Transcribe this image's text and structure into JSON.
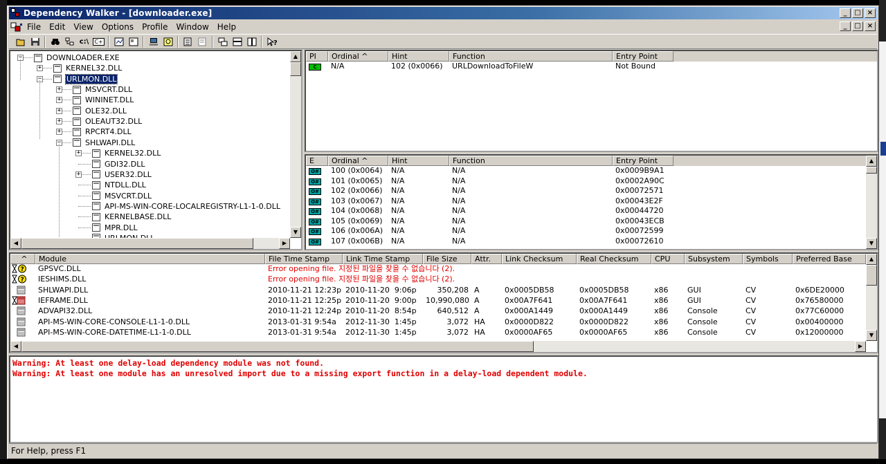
{
  "window": {
    "title": "Dependency Walker - [downloader.exe]",
    "btn_min": "_",
    "btn_max": "□",
    "btn_close": "×"
  },
  "menu": [
    "File",
    "Edit",
    "View",
    "Options",
    "Profile",
    "Window",
    "Help"
  ],
  "toolbar": {
    "c_label": "c:\\",
    "cplus_label": "C+"
  },
  "tree": [
    {
      "label": "DOWNLOADER.EXE",
      "depth": 0,
      "expander": "−"
    },
    {
      "label": "KERNEL32.DLL",
      "depth": 1,
      "expander": "+"
    },
    {
      "label": "URLMON.DLL",
      "depth": 1,
      "expander": "−",
      "selected": true
    },
    {
      "label": "MSVCRT.DLL",
      "depth": 2,
      "expander": "+"
    },
    {
      "label": "WININET.DLL",
      "depth": 2,
      "expander": "+"
    },
    {
      "label": "OLE32.DLL",
      "depth": 2,
      "expander": "+"
    },
    {
      "label": "OLEAUT32.DLL",
      "depth": 2,
      "expander": "+"
    },
    {
      "label": "RPCRT4.DLL",
      "depth": 2,
      "expander": "+"
    },
    {
      "label": "SHLWAPI.DLL",
      "depth": 2,
      "expander": "−"
    },
    {
      "label": "KERNEL32.DLL",
      "depth": 3,
      "expander": "+"
    },
    {
      "label": "GDI32.DLL",
      "depth": 3,
      "expander": ""
    },
    {
      "label": "USER32.DLL",
      "depth": 3,
      "expander": "+"
    },
    {
      "label": "NTDLL.DLL",
      "depth": 3,
      "expander": ""
    },
    {
      "label": "MSVCRT.DLL",
      "depth": 3,
      "expander": ""
    },
    {
      "label": "API-MS-WIN-CORE-LOCALREGISTRY-L1-1-0.DLL",
      "depth": 3,
      "expander": ""
    },
    {
      "label": "KERNELBASE.DLL",
      "depth": 3,
      "expander": ""
    },
    {
      "label": "MPR.DLL",
      "depth": 3,
      "expander": ""
    },
    {
      "label": "URLMON.DLL",
      "depth": 3,
      "expander": ""
    }
  ],
  "imports": {
    "headers": [
      "PI",
      "Ordinal ^",
      "Hint",
      "Function",
      "Entry Point"
    ],
    "rows": [
      {
        "badge": "C",
        "ordinal": "N/A",
        "hint": "102 (0x0066)",
        "function": "URLDownloadToFileW",
        "entry": "Not Bound"
      }
    ]
  },
  "exports": {
    "headers": [
      "E",
      "Ordinal ^",
      "Hint",
      "Function",
      "Entry Point"
    ],
    "badge": "O#",
    "rows": [
      {
        "ordinal": "100 (0x0064)",
        "hint": "N/A",
        "function": "N/A",
        "entry": "0x0009B9A1"
      },
      {
        "ordinal": "101 (0x0065)",
        "hint": "N/A",
        "function": "N/A",
        "entry": "0x0002A90C"
      },
      {
        "ordinal": "102 (0x0066)",
        "hint": "N/A",
        "function": "N/A",
        "entry": "0x00072571"
      },
      {
        "ordinal": "103 (0x0067)",
        "hint": "N/A",
        "function": "N/A",
        "entry": "0x00043E2F"
      },
      {
        "ordinal": "104 (0x0068)",
        "hint": "N/A",
        "function": "N/A",
        "entry": "0x00044720"
      },
      {
        "ordinal": "105 (0x0069)",
        "hint": "N/A",
        "function": "N/A",
        "entry": "0x00043ECB"
      },
      {
        "ordinal": "106 (0x006A)",
        "hint": "N/A",
        "function": "N/A",
        "entry": "0x00072599"
      },
      {
        "ordinal": "107 (0x006B)",
        "hint": "N/A",
        "function": "N/A",
        "entry": "0x00072610"
      }
    ]
  },
  "modules": {
    "headers": [
      "^",
      "Module",
      "File Time Stamp",
      "Link Time Stamp",
      "File Size",
      "Attr.",
      "Link Checksum",
      "Real Checksum",
      "CPU",
      "Subsystem",
      "Symbols",
      "Preferred Base"
    ],
    "rows": [
      {
        "icon": "missing",
        "module": "GPSVC.DLL",
        "error": "Error opening file. 지정된 파일을 찾을 수 없습니다 (2)."
      },
      {
        "icon": "missing",
        "module": "IESHIMS.DLL",
        "error": "Error opening file. 지정된 파일을 찾을 수 없습니다 (2)."
      },
      {
        "icon": "ok",
        "module": "SHLWAPI.DLL",
        "fts": "2010-11-21 12:23p",
        "lts": "2010-11-20  9:06p",
        "size": "350,208",
        "attr": "A",
        "lcs": "0x0005DB58",
        "rcs": "0x0005DB58",
        "cpu": "x86",
        "sub": "GUI",
        "sym": "CV",
        "base": "0x6DE20000"
      },
      {
        "icon": "delay-error",
        "module": "IEFRAME.DLL",
        "fts": "2010-11-21 12:25p",
        "lts": "2010-11-20  9:00p",
        "size": "10,990,080",
        "attr": "A",
        "lcs": "0x00A7F641",
        "rcs": "0x00A7F641",
        "cpu": "x86",
        "sub": "GUI",
        "sym": "CV",
        "base": "0x76580000"
      },
      {
        "icon": "ok",
        "module": "ADVAPI32.DLL",
        "fts": "2010-11-21 12:24p",
        "lts": "2010-11-20  8:54p",
        "size": "640,512",
        "attr": "A",
        "lcs": "0x000A1449",
        "rcs": "0x000A1449",
        "cpu": "x86",
        "sub": "Console",
        "sym": "CV",
        "base": "0x77C60000"
      },
      {
        "icon": "ok",
        "module": "API-MS-WIN-CORE-CONSOLE-L1-1-0.DLL",
        "fts": "2013-01-31  9:54a",
        "lts": "2012-11-30  1:45p",
        "size": "3,072",
        "attr": "HA",
        "lcs": "0x0000D822",
        "rcs": "0x0000D822",
        "cpu": "x86",
        "sub": "Console",
        "sym": "CV",
        "base": "0x00400000"
      },
      {
        "icon": "ok",
        "module": "API-MS-WIN-CORE-DATETIME-L1-1-0.DLL",
        "fts": "2013-01-31  9:54a",
        "lts": "2012-11-30  1:45p",
        "size": "3,072",
        "attr": "HA",
        "lcs": "0x0000AF65",
        "rcs": "0x0000AF65",
        "cpu": "x86",
        "sub": "Console",
        "sym": "CV",
        "base": "0x12000000"
      }
    ]
  },
  "log": [
    "Warning: At least one delay-load dependency module was not found.",
    "Warning: At least one module has an unresolved import due to a missing export function in a delay-load dependent module."
  ],
  "status": "For Help, press F1",
  "colors": {
    "title_start": "#0a246a",
    "selection": "#0a246a",
    "error_red": "#e00000",
    "export_badge": "#00a0a0",
    "import_badge": "#00c000"
  }
}
